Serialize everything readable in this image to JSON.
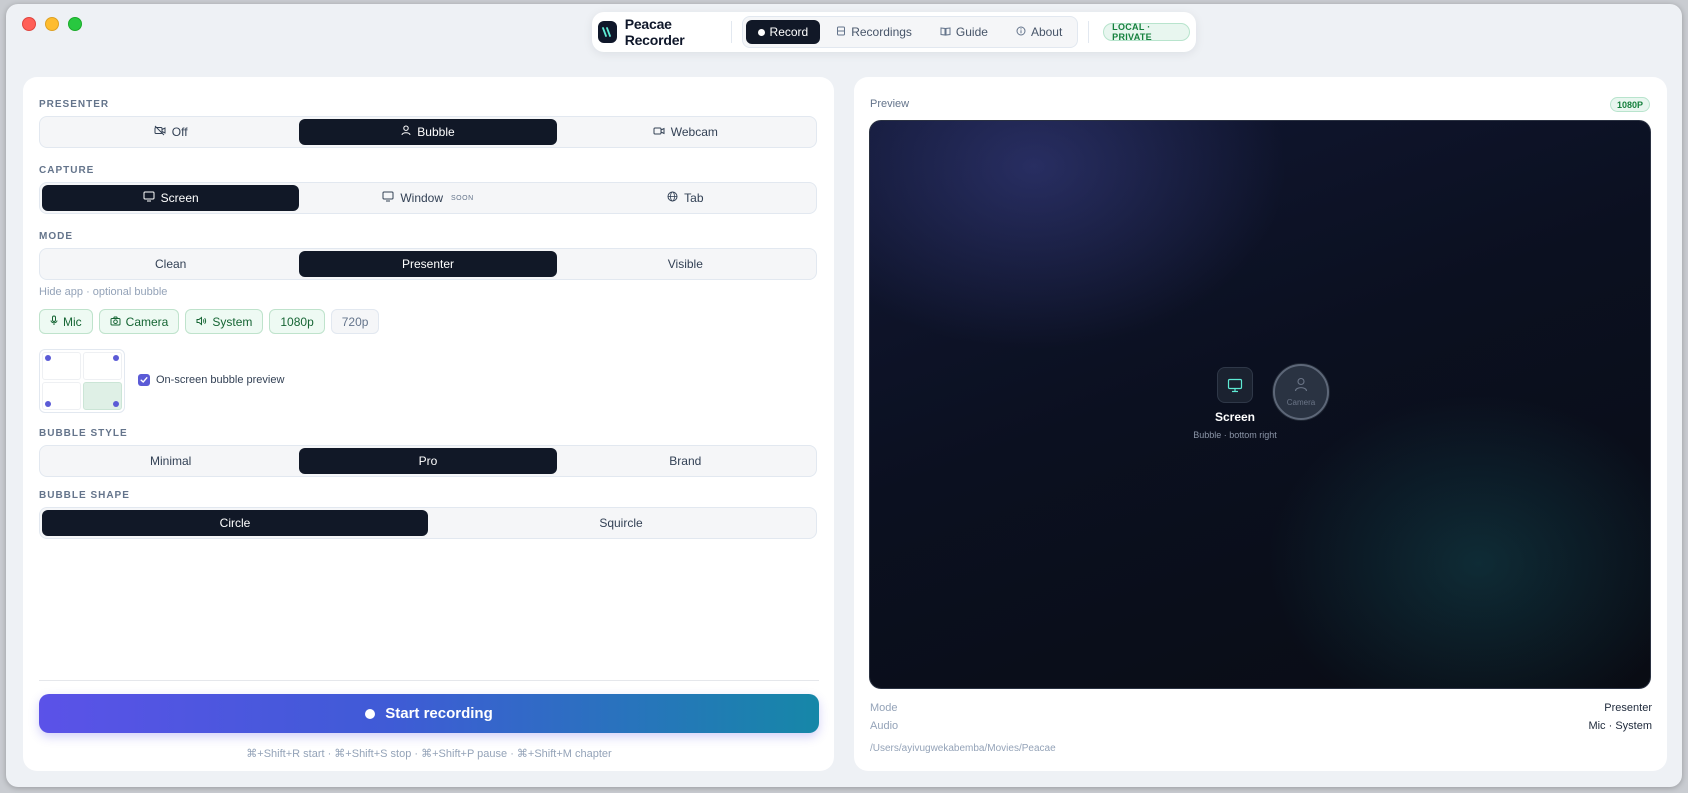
{
  "app": {
    "name": "Peacae Recorder",
    "privacy_badge": "LOCAL · PRIVATE"
  },
  "nav": {
    "tabs": [
      {
        "label": "Record",
        "active": true,
        "icon": "record-dot-icon"
      },
      {
        "label": "Recordings",
        "active": false,
        "icon": "film-icon"
      },
      {
        "label": "Guide",
        "active": false,
        "icon": "book-icon"
      },
      {
        "label": "About",
        "active": false,
        "icon": "info-icon"
      }
    ]
  },
  "presenter": {
    "label": "PRESENTER",
    "options": [
      {
        "label": "Off",
        "icon": "camera-off-icon"
      },
      {
        "label": "Bubble",
        "icon": "user-icon"
      },
      {
        "label": "Webcam",
        "icon": "video-icon"
      }
    ],
    "selected": "Bubble"
  },
  "capture": {
    "label": "CAPTURE",
    "options": [
      {
        "label": "Screen",
        "icon": "monitor-icon"
      },
      {
        "label": "Window",
        "icon": "monitor-icon",
        "tag": "SOON"
      },
      {
        "label": "Tab",
        "icon": "globe-icon"
      }
    ],
    "selected": "Screen"
  },
  "mode": {
    "label": "MODE",
    "options": [
      "Clean",
      "Presenter",
      "Visible"
    ],
    "selected": "Presenter",
    "hint": "Hide app · optional bubble"
  },
  "toggles": [
    {
      "label": "Mic",
      "on": true,
      "icon": "mic-icon"
    },
    {
      "label": "Camera",
      "on": true,
      "icon": "camera-icon"
    },
    {
      "label": "System",
      "on": true,
      "icon": "speaker-icon"
    },
    {
      "label": "1080p",
      "on": true
    },
    {
      "label": "720p",
      "on": false
    }
  ],
  "bubble_position": {
    "selected": "bottom-right",
    "preview_label": "On-screen bubble preview",
    "preview_checked": true
  },
  "bubble_style": {
    "label": "BUBBLE STYLE",
    "options": [
      "Minimal",
      "Pro",
      "Brand"
    ],
    "selected": "Pro"
  },
  "bubble_shape": {
    "label": "BUBBLE SHAPE",
    "options": [
      "Circle",
      "Squircle"
    ],
    "selected": "Circle"
  },
  "start": {
    "label": "Start recording",
    "shortcuts": "⌘+Shift+R start · ⌘+Shift+S stop · ⌘+Shift+P pause · ⌘+Shift+M chapter"
  },
  "preview": {
    "label": "Preview",
    "resolution_badge": "1080P",
    "screen_label": "Screen",
    "screen_sub": "Bubble · bottom right",
    "bubble_label": "Camera",
    "info": [
      {
        "key": "Mode",
        "value": "Presenter"
      },
      {
        "key": "Audio",
        "value": "Mic · System"
      }
    ],
    "path": "/Users/ayivugwekabemba/Movies/Peacae"
  },
  "colors": {
    "accent": "#5b5bd6",
    "dark": "#111827",
    "success": "#15803d",
    "start_gradient": [
      "#5b52e8",
      "#1687a8"
    ]
  }
}
